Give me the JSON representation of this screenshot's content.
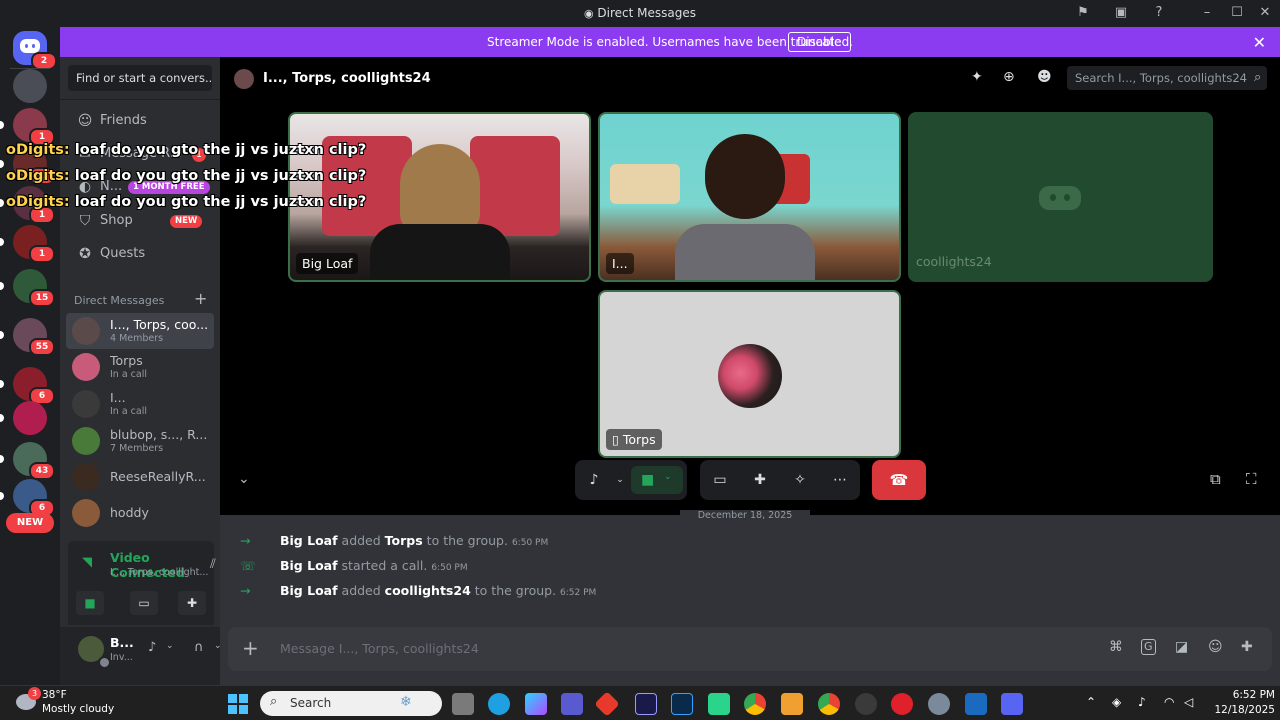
{
  "window": {
    "title": "Direct Messages"
  },
  "banner": {
    "text": "Streamer Mode is enabled. Usernames have been truncated.",
    "button": "Disable"
  },
  "rail": {
    "home_badge": "2",
    "servers": [
      {
        "badge": "1",
        "color": "#8a3a4a"
      },
      {
        "badge": "1",
        "color": "#6b2a2a"
      },
      {
        "badge": "1",
        "color": "#5a3040"
      },
      {
        "badge": "1",
        "color": "#7a2020"
      },
      {
        "badge": "15",
        "color": "#2f5a3a"
      },
      {
        "badge": "55",
        "color": "#6a4a5a"
      },
      {
        "badge": "6",
        "color": "#8a1e2a"
      },
      {
        "badge": "",
        "color": "#b01e50"
      },
      {
        "badge": "43",
        "color": "#4a6a5a"
      },
      {
        "badge": "6",
        "color": "#3a5a8a"
      }
    ],
    "new_label": "NEW"
  },
  "sidebar": {
    "find": "Find or start a convers...",
    "nav": [
      {
        "label": "Friends",
        "icon": "friends-icon"
      },
      {
        "label": "Message R...",
        "icon": "message-requests-icon",
        "badge": "1"
      },
      {
        "label": "N...",
        "icon": "nitro-icon",
        "promo": "1 MONTH FREE"
      },
      {
        "label": "Shop",
        "icon": "shop-icon",
        "promo": "NEW"
      },
      {
        "label": "Quests",
        "icon": "quests-icon"
      }
    ],
    "dm_header": "Direct Messages",
    "dms": [
      {
        "name": "I..., Torps, coo...",
        "sub": "4 Members",
        "color": "#5a4a4a",
        "active": true
      },
      {
        "name": "Torps",
        "sub": "In a call",
        "color": "#c85a7a"
      },
      {
        "name": "I...",
        "sub": "In a call",
        "color": "#3a3a3a"
      },
      {
        "name": "blubop, s..., R...",
        "sub": "7 Members",
        "color": "#4a7a3a"
      },
      {
        "name": "ReeseReallyR...",
        "sub": "",
        "color": "#3a2a20"
      },
      {
        "name": "hoddy",
        "sub": "",
        "color": "#8a5a3a"
      }
    ]
  },
  "voice_panel": {
    "status": "Video Connected",
    "channel": "I..., Torps, coollight..."
  },
  "user_panel": {
    "name": "B...",
    "status": "Inv..."
  },
  "call": {
    "header_title": "I..., Torps, coollights24",
    "search_placeholder": "Search I..., Torps, coollights24",
    "tiles": [
      {
        "label": "Big Loaf"
      },
      {
        "label": "I..."
      },
      {
        "label": "coollights24"
      },
      {
        "label": "Torps"
      }
    ]
  },
  "overlay": {
    "lines": [
      {
        "name": "oDigits:",
        "text": "loaf do you gto the jj vs juztxn clip?"
      },
      {
        "name": "oDigits:",
        "text": "loaf do you gto the jj vs juztxn clip?"
      },
      {
        "name": "oDigits:",
        "text": "loaf do you gto the jj vs juztxn clip?"
      }
    ]
  },
  "messages": {
    "date": "December 18, 2025",
    "items": [
      {
        "actor": "Big Loaf",
        "verb": "added",
        "target": "Torps",
        "rest": "to the group.",
        "time": "6:50 PM",
        "icon": "arrow-right-icon"
      },
      {
        "actor": "Big Loaf",
        "verb": "started a call.",
        "target": "",
        "rest": "",
        "time": "6:50 PM",
        "icon": "phone-icon"
      },
      {
        "actor": "Big Loaf",
        "verb": "added",
        "target": "coollights24",
        "rest": "to the group.",
        "time": "6:52 PM",
        "icon": "arrow-right-icon"
      }
    ]
  },
  "composer": {
    "placeholder": "Message I..., Torps, coollights24"
  },
  "taskbar": {
    "weather_temp": "38°F",
    "weather_desc": "Mostly cloudy",
    "weather_badge": "3",
    "search": "Search",
    "time": "6:52 PM",
    "date": "12/18/2025"
  },
  "colors": {
    "accent": "#5865f2",
    "banner": "#8c3cf0",
    "danger": "#da373c",
    "online": "#23a55a"
  }
}
